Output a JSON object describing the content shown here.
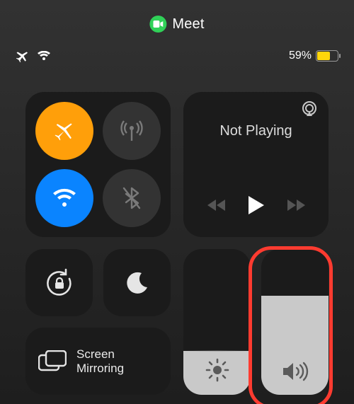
{
  "pill": {
    "app_label": "Meet"
  },
  "status": {
    "battery_pct": "59%",
    "battery_fill_pct": 59
  },
  "connectivity": {
    "airplane": {
      "on": true
    },
    "cellular": {
      "on": false
    },
    "wifi": {
      "on": true
    },
    "bluetooth": {
      "on": false
    }
  },
  "media": {
    "now_playing_label": "Not Playing"
  },
  "rotation_lock": {
    "locked": true
  },
  "dnd": {
    "on": false
  },
  "screen_mirroring": {
    "label": "Screen\nMirroring"
  },
  "brightness": {
    "level_pct": 30
  },
  "volume": {
    "level_pct": 68
  }
}
